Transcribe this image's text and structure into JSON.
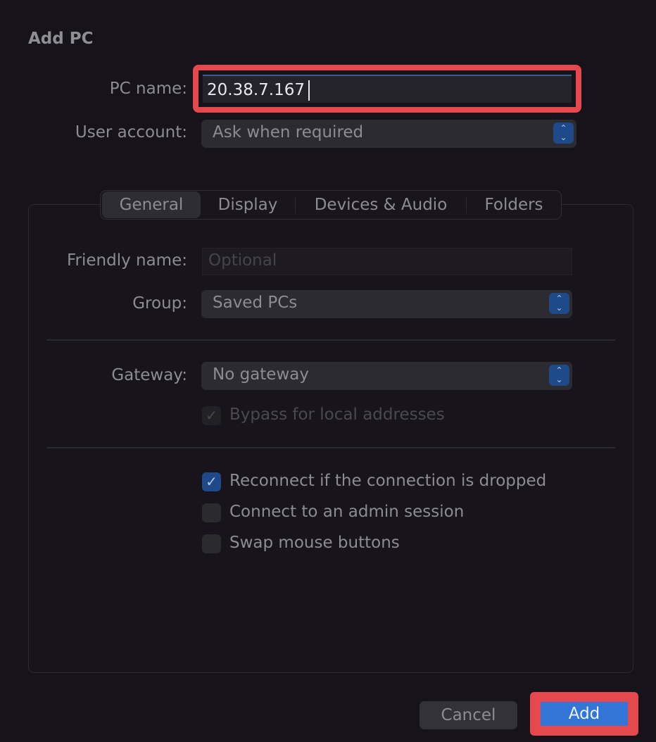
{
  "dialog": {
    "title": "Add PC"
  },
  "pc_name": {
    "label": "PC name:",
    "value": "20.38.7.167"
  },
  "user_account": {
    "label": "User account:",
    "value": "Ask when required"
  },
  "tabs": [
    {
      "label": "General",
      "selected": true
    },
    {
      "label": "Display",
      "selected": false
    },
    {
      "label": "Devices & Audio",
      "selected": false
    },
    {
      "label": "Folders",
      "selected": false
    }
  ],
  "general": {
    "friendly_name": {
      "label": "Friendly name:",
      "placeholder": "Optional",
      "value": ""
    },
    "group": {
      "label": "Group:",
      "value": "Saved PCs"
    },
    "gateway": {
      "label": "Gateway:",
      "value": "No gateway"
    },
    "bypass": {
      "label": "Bypass for local addresses",
      "checked": true,
      "enabled": false
    },
    "options": [
      {
        "label": "Reconnect if the connection is dropped",
        "checked": true
      },
      {
        "label": "Connect to an admin session",
        "checked": false
      },
      {
        "label": "Swap mouse buttons",
        "checked": false
      }
    ]
  },
  "buttons": {
    "cancel": "Cancel",
    "add": "Add"
  },
  "colors": {
    "accent": "#3275d6",
    "highlight": "#e5484d",
    "background": "#16141a"
  }
}
